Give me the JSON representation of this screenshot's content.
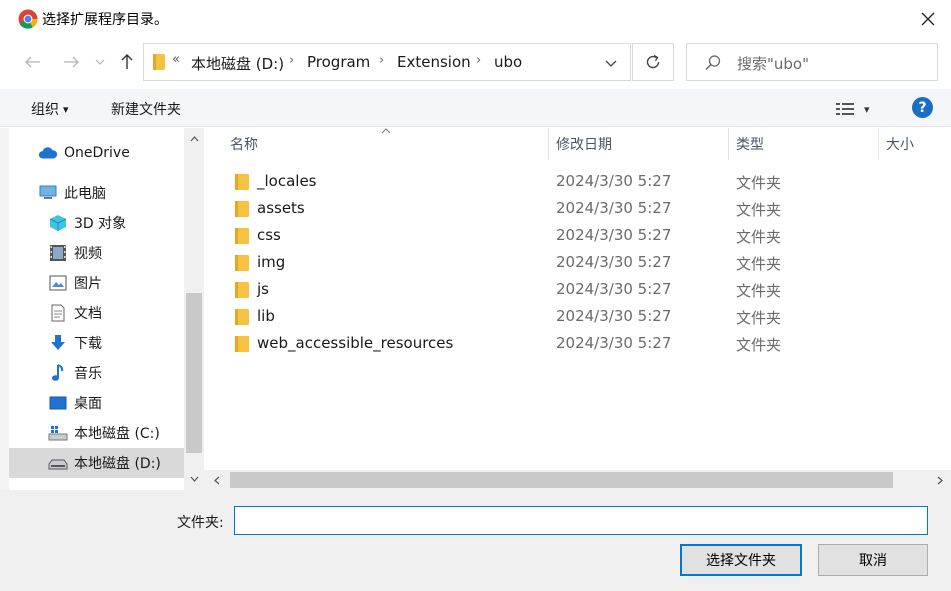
{
  "window": {
    "title": "选择扩展程序目录。",
    "close_glyph": "✕"
  },
  "nav_buttons": {
    "back": "←",
    "forward": "→",
    "recent": "⌄",
    "up": "↑"
  },
  "address": {
    "more": "«",
    "crumbs": [
      "本地磁盘 (D:)",
      "Program",
      "Extension",
      "ubo"
    ],
    "separator": "›"
  },
  "search": {
    "placeholder": "搜索\"ubo\""
  },
  "toolbar": {
    "organize_label": "组织",
    "organize_caret": "▾",
    "new_folder_label": "新建文件夹",
    "view_caret": "▾",
    "help_label": "?"
  },
  "sidebar": {
    "items": [
      {
        "label": "OneDrive",
        "icon": "cloud-icon"
      },
      {
        "label": "此电脑",
        "icon": "computer-icon"
      },
      {
        "label": "3D 对象",
        "icon": "cube-icon"
      },
      {
        "label": "视频",
        "icon": "video-icon"
      },
      {
        "label": "图片",
        "icon": "picture-icon"
      },
      {
        "label": "文档",
        "icon": "document-icon"
      },
      {
        "label": "下载",
        "icon": "download-icon"
      },
      {
        "label": "音乐",
        "icon": "music-icon"
      },
      {
        "label": "桌面",
        "icon": "desktop-icon"
      },
      {
        "label": "本地磁盘 (C:)",
        "icon": "drive-c-icon"
      },
      {
        "label": "本地磁盘 (D:)",
        "icon": "drive-d-icon",
        "selected": true
      }
    ]
  },
  "columns": {
    "name": "名称",
    "modified": "修改日期",
    "type": "类型",
    "size": "大小"
  },
  "files": [
    {
      "name": "_locales",
      "modified": "2024/3/30 5:27",
      "type": "文件夹"
    },
    {
      "name": "assets",
      "modified": "2024/3/30 5:27",
      "type": "文件夹"
    },
    {
      "name": "css",
      "modified": "2024/3/30 5:27",
      "type": "文件夹"
    },
    {
      "name": "img",
      "modified": "2024/3/30 5:27",
      "type": "文件夹"
    },
    {
      "name": "js",
      "modified": "2024/3/30 5:27",
      "type": "文件夹"
    },
    {
      "name": "lib",
      "modified": "2024/3/30 5:27",
      "type": "文件夹"
    },
    {
      "name": "web_accessible_resources",
      "modified": "2024/3/30 5:27",
      "type": "文件夹"
    }
  ],
  "footer": {
    "folder_label": "文件夹:",
    "folder_value": "",
    "select_button": "选择文件夹",
    "cancel_button": "取消"
  },
  "colors": {
    "accent": "#0078d7",
    "folder": "#f5c242",
    "selected_nav": "#d9d9d9",
    "help": "#1a6fc2"
  }
}
